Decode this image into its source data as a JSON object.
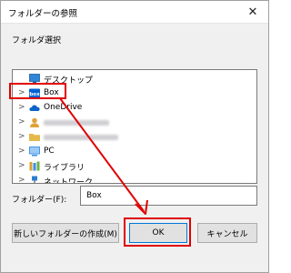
{
  "window": {
    "title": "フォルダーの参照",
    "close_glyph": "✕"
  },
  "caption": "フォルダ選択",
  "tree": {
    "items": [
      {
        "label": "デスクトップ",
        "chevron": "",
        "icon": "desktop-icon",
        "color": "#2f86d6"
      },
      {
        "label": "Box",
        "chevron": ">",
        "icon": "box-icon",
        "color": "#0061d5"
      },
      {
        "label": "OneDrive",
        "chevron": ">",
        "icon": "onedrive-icon",
        "color": "#0a64c8"
      },
      {
        "label": "",
        "chevron": ">",
        "icon": "user-icon",
        "color": "#e0a23a"
      },
      {
        "label": "",
        "chevron": ">",
        "icon": "folder-icon",
        "color": "#e6b84a"
      },
      {
        "label": "PC",
        "chevron": ">",
        "icon": "pc-icon",
        "color": "#3a8ee6"
      },
      {
        "label": "ライブラリ",
        "chevron": ">",
        "icon": "library-icon",
        "color": "#d9a22c"
      },
      {
        "label": "ネットワーク",
        "chevron": ">",
        "icon": "network-icon",
        "color": "#2d7fd0"
      }
    ]
  },
  "folder": {
    "label": "フォルダー(F):",
    "value": "Box"
  },
  "buttons": {
    "new_folder": "新しいフォルダーの作成(M)",
    "ok": "OK",
    "cancel": "キャンセル"
  },
  "annotation_color": "#e00000"
}
